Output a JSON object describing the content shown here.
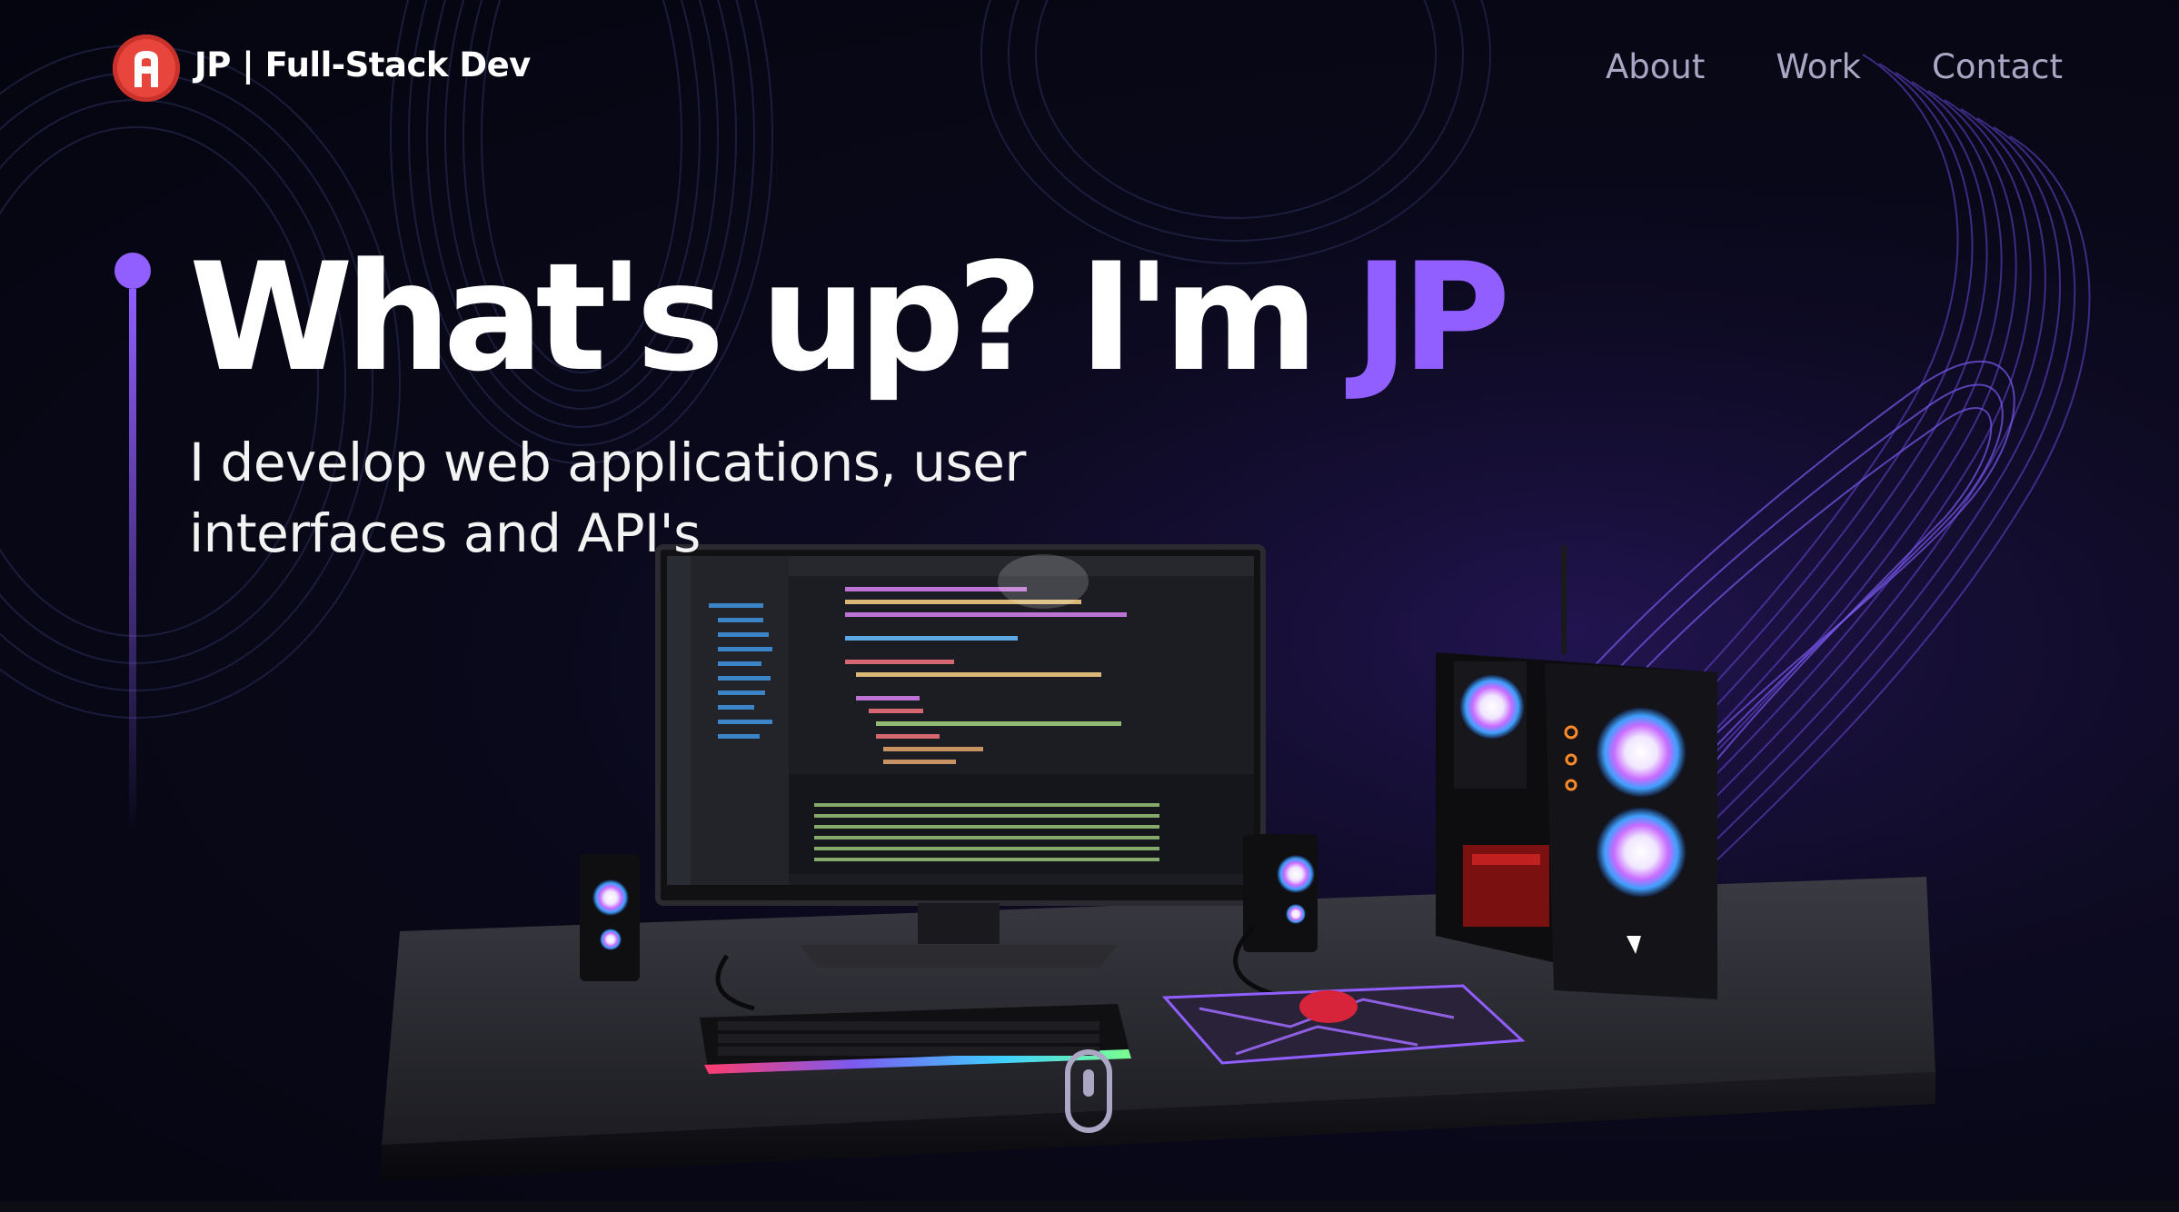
{
  "nav": {
    "brand": "JP  | Full-Stack Dev",
    "links": [
      "About",
      "Work",
      "Contact"
    ]
  },
  "hero": {
    "title_prefix": "What's up? I'm ",
    "title_name": "JP",
    "subtitle": "I develop web applications, user interfaces and API's"
  },
  "colors": {
    "accent": "#915eff",
    "nav_link": "#aaa6c3",
    "logo": "#e8453c",
    "background": "#060613"
  },
  "icons": [
    "logo-icon",
    "scroll-mouse-icon"
  ]
}
